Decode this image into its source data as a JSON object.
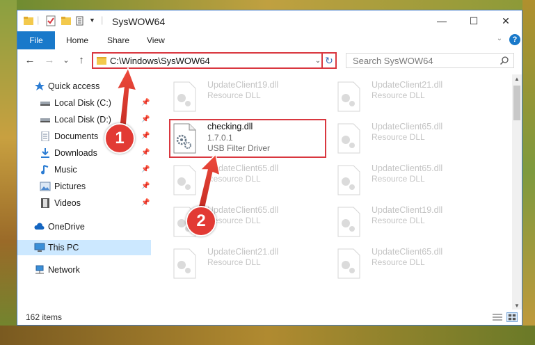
{
  "window": {
    "title": "SysWOW64",
    "controls": {
      "minimize": "—",
      "maximize": "☐",
      "close": "✕"
    }
  },
  "ribbon": {
    "tabs": [
      "File",
      "Home",
      "Share",
      "View"
    ],
    "help_label": "?"
  },
  "nav": {
    "back": "←",
    "forward": "→",
    "recent": "⌄",
    "up": "↑",
    "address": "C:\\Windows\\SysWOW64",
    "refresh": "↻",
    "search_placeholder": "Search SysWOW64"
  },
  "sidebar": {
    "items": [
      {
        "label": "Quick access",
        "icon": "star-icon"
      },
      {
        "label": "Local Disk (C:)",
        "icon": "drive-icon",
        "pinned": true
      },
      {
        "label": "Local Disk (D:)",
        "icon": "drive-icon",
        "pinned": true
      },
      {
        "label": "Documents",
        "icon": "documents-icon",
        "pinned": true
      },
      {
        "label": "Downloads",
        "icon": "downloads-icon",
        "pinned": true
      },
      {
        "label": "Music",
        "icon": "music-icon",
        "pinned": true
      },
      {
        "label": "Pictures",
        "icon": "pictures-icon",
        "pinned": true
      },
      {
        "label": "Videos",
        "icon": "videos-icon",
        "pinned": true
      },
      {
        "label": "OneDrive",
        "icon": "cloud-icon"
      },
      {
        "label": "This PC",
        "icon": "computer-icon",
        "selected": true
      },
      {
        "label": "Network",
        "icon": "network-icon"
      }
    ]
  },
  "files": {
    "col1": [
      {
        "name": "UpdateClient19.dll",
        "type": "Resource DLL"
      },
      {
        "name": "checking.dll",
        "version": "1.7.0.1",
        "type": "USB Filter Driver"
      },
      {
        "name": "UpdateClient65.dll",
        "type": "Resource DLL"
      },
      {
        "name": "UpdateClient65.dll",
        "type": "Resource DLL"
      },
      {
        "name": "UpdateClient21.dll",
        "type": "Resource DLL"
      }
    ],
    "col2": [
      {
        "name": "UpdateClient21.dll",
        "type": "Resource DLL"
      },
      {
        "name": "UpdateClient65.dll",
        "type": "Resource DLL"
      },
      {
        "name": "UpdateClient65.dll",
        "type": "Resource DLL"
      },
      {
        "name": "UpdateClient19.dll",
        "type": "Resource DLL"
      },
      {
        "name": "UpdateClient65.dll",
        "type": "Resource DLL"
      }
    ]
  },
  "status": {
    "item_count": "162 items"
  },
  "annotations": {
    "step1": "1",
    "step2": "2"
  },
  "colors": {
    "accent": "#1979ca",
    "highlight": "#d9373f",
    "selected": "#cce8ff"
  }
}
